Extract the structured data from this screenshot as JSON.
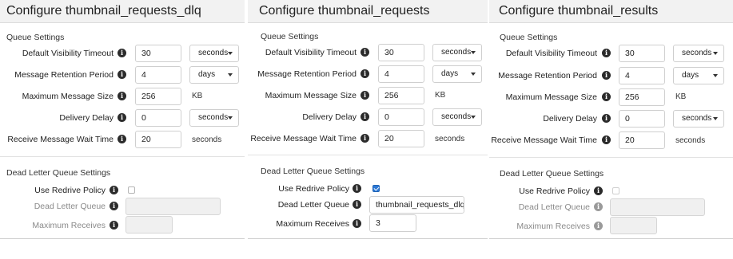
{
  "panels": [
    {
      "title": "Configure thumbnail_requests_dlq",
      "queue_settings_heading": "Queue Settings",
      "visibility_timeout": {
        "label": "Default Visibility Timeout",
        "value": "30",
        "unit": "seconds"
      },
      "retention_period": {
        "label": "Message Retention Period",
        "value": "4",
        "unit": "days"
      },
      "max_message_size": {
        "label": "Maximum Message Size",
        "value": "256",
        "unit": "KB"
      },
      "delivery_delay": {
        "label": "Delivery Delay",
        "value": "0",
        "unit": "seconds"
      },
      "receive_wait_time": {
        "label": "Receive Message Wait Time",
        "value": "20",
        "unit": "seconds"
      },
      "dlq_heading": "Dead Letter Queue Settings",
      "use_redrive_policy": {
        "label": "Use Redrive Policy",
        "checked": false
      },
      "dead_letter_queue": {
        "label": "Dead Letter Queue",
        "value": ""
      },
      "max_receives": {
        "label": "Maximum Receives",
        "value": ""
      }
    },
    {
      "title": "Configure thumbnail_requests",
      "queue_settings_heading": "Queue Settings",
      "visibility_timeout": {
        "label": "Default Visibility Timeout",
        "value": "30",
        "unit": "seconds"
      },
      "retention_period": {
        "label": "Message Retention Period",
        "value": "4",
        "unit": "days"
      },
      "max_message_size": {
        "label": "Maximum Message Size",
        "value": "256",
        "unit": "KB"
      },
      "delivery_delay": {
        "label": "Delivery Delay",
        "value": "0",
        "unit": "seconds"
      },
      "receive_wait_time": {
        "label": "Receive Message Wait Time",
        "value": "20",
        "unit": "seconds"
      },
      "dlq_heading": "Dead Letter Queue Settings",
      "use_redrive_policy": {
        "label": "Use Redrive Policy",
        "checked": true
      },
      "dead_letter_queue": {
        "label": "Dead Letter Queue",
        "value": "thumbnail_requests_dlq"
      },
      "max_receives": {
        "label": "Maximum Receives",
        "value": "3"
      }
    },
    {
      "title": "Configure thumbnail_results",
      "queue_settings_heading": "Queue Settings",
      "visibility_timeout": {
        "label": "Default Visibility Timeout",
        "value": "30",
        "unit": "seconds"
      },
      "retention_period": {
        "label": "Message Retention Period",
        "value": "4",
        "unit": "days"
      },
      "max_message_size": {
        "label": "Maximum Message Size",
        "value": "256",
        "unit": "KB"
      },
      "delivery_delay": {
        "label": "Delivery Delay",
        "value": "0",
        "unit": "seconds"
      },
      "receive_wait_time": {
        "label": "Receive Message Wait Time",
        "value": "20",
        "unit": "seconds"
      },
      "dlq_heading": "Dead Letter Queue Settings",
      "use_redrive_policy": {
        "label": "Use Redrive Policy",
        "checked": false
      },
      "dead_letter_queue": {
        "label": "Dead Letter Queue",
        "value": ""
      },
      "max_receives": {
        "label": "Maximum Receives",
        "value": ""
      }
    }
  ],
  "icons": {
    "info": "info-icon",
    "dropdown": "chevron-down-icon",
    "checkbox": "checkbox-icon"
  },
  "colors": {
    "title_bar": "#f2f2f2",
    "checkbox_checked": "#2d79d6",
    "disabled_field": "#f0f0f0"
  }
}
